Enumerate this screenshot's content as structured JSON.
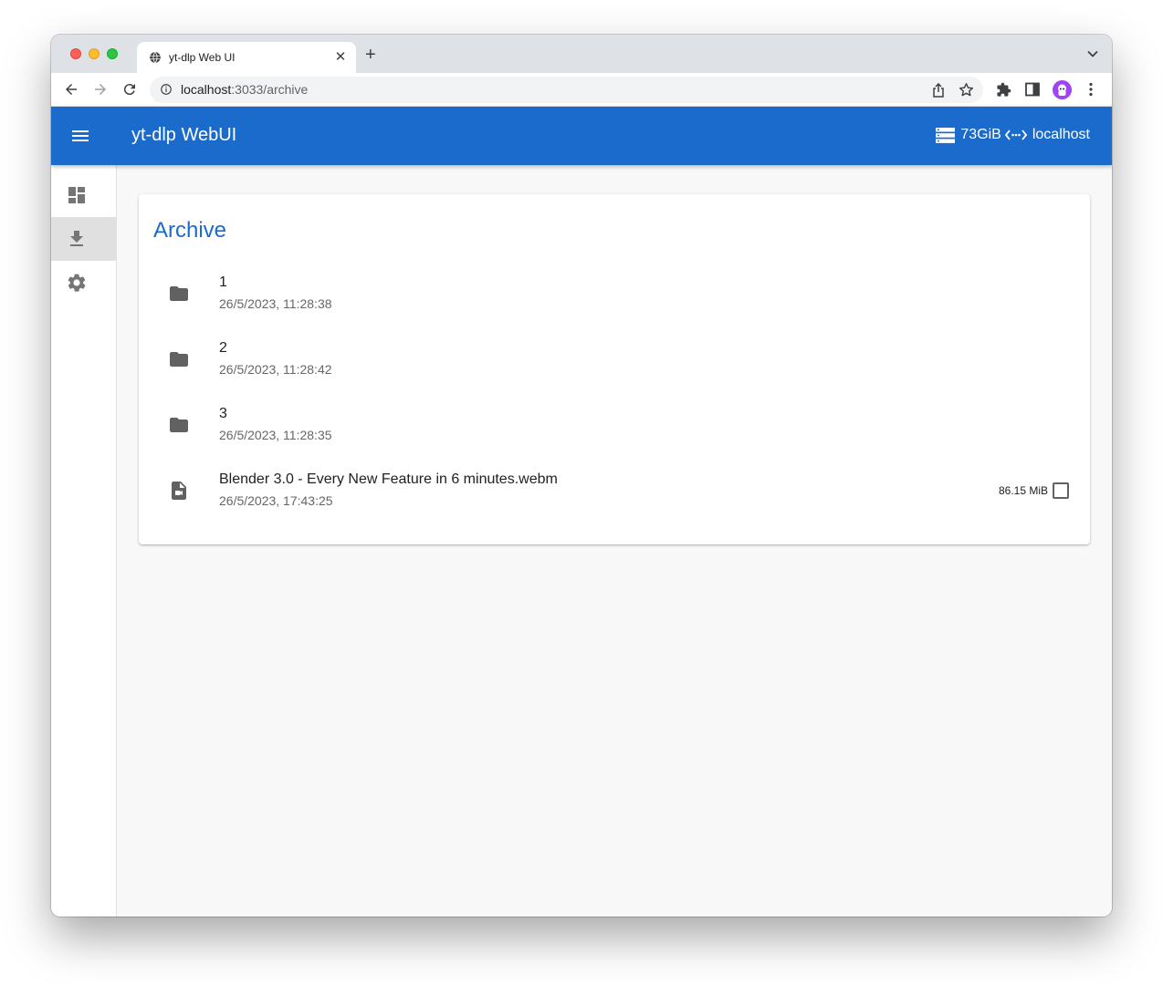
{
  "browser": {
    "tab_title": "yt-dlp Web UI",
    "url_host": "localhost",
    "url_path": ":3033/archive"
  },
  "app": {
    "title": "yt-dlp WebUI",
    "free_space": "73GiB",
    "server": "localhost"
  },
  "sidebar": {
    "items": [
      {
        "icon": "dashboard-icon",
        "active": false
      },
      {
        "icon": "download-icon",
        "active": true
      },
      {
        "icon": "settings-icon",
        "active": false
      }
    ]
  },
  "archive": {
    "title": "Archive",
    "rows": [
      {
        "type": "folder",
        "name": "1",
        "date": "26/5/2023, 11:28:38"
      },
      {
        "type": "folder",
        "name": "2",
        "date": "26/5/2023, 11:28:42"
      },
      {
        "type": "folder",
        "name": "3",
        "date": "26/5/2023, 11:28:35"
      },
      {
        "type": "video-file",
        "name": "Blender 3.0 - Every New Feature in 6 minutes.webm",
        "date": "26/5/2023, 17:43:25",
        "size": "86.15 MiB"
      }
    ]
  },
  "colors": {
    "primary": "#1a6bcc",
    "tab_strip": "#dee1e6"
  }
}
